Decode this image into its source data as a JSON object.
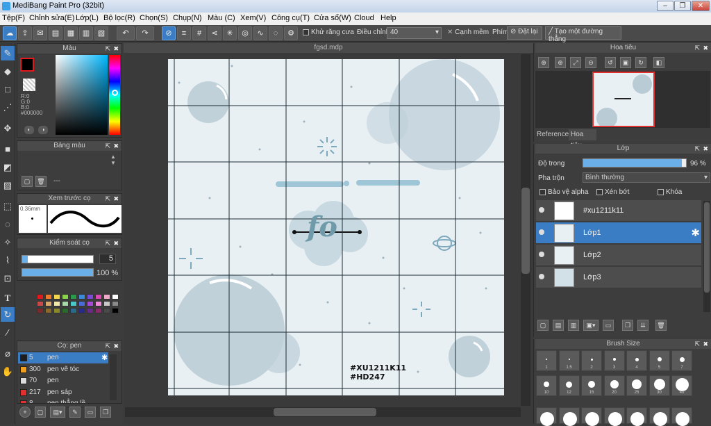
{
  "window": {
    "title": "MediBang Paint Pro (32bit)"
  },
  "menu": [
    "Tệp(F)",
    "Chỉnh sửa(E)",
    "Lớp(L)",
    "Bộ lọc(R)",
    "Chọn(S)",
    "Chụp(N)",
    "Màu (C)",
    "Xem(V)",
    "Công cụ(T)",
    "Cửa sổ(W)",
    "Cloud",
    "Help"
  ],
  "toolbar": {
    "antialias_label": "Khử răng cưa",
    "adjust_label": "Điều chỉnh",
    "adjust_value": "40",
    "soft_edge_label": "Cạnh mềm",
    "key_label": "Phím",
    "reset_label": "Đặt lại",
    "straight_line_label": "Tạo một đường thẳng"
  },
  "color_panel": {
    "title": "Màu",
    "r": "R:0",
    "g": "G:0",
    "b": "B:0",
    "hex": "#000000"
  },
  "palette_panel": {
    "title": "Bảng màu",
    "dash": "---",
    "colors": [
      "#e01a1a",
      "#f07a2a",
      "#f0d84a",
      "#8ad24a",
      "#2a9a4a",
      "#3a8ad8",
      "#7a4ad8",
      "#d84ab0",
      "#f0a8c8",
      "#ffffff",
      "#c84a4a",
      "#d8a86a",
      "#f0e8a8",
      "#a8d8a8",
      "#4ac8c8",
      "#4a6ad8",
      "#a84ad8",
      "#f08ad8",
      "#c8c8c8",
      "#8a8a8a",
      "#7a2a2a",
      "#8a6a2a",
      "#8a8a2a",
      "#2a6a2a",
      "#2a6a8a",
      "#2a2a8a",
      "#6a2a8a",
      "#8a2a6a",
      "#4a4a4a",
      "#000000"
    ]
  },
  "brush_preview": {
    "title": "Xem trước cọ",
    "size": "0.36mm"
  },
  "brush_control": {
    "title": "Kiểm soát cọ",
    "size_value": "5",
    "opacity_value": "100 %",
    "opacity_fraction": 1.0
  },
  "pen_panel": {
    "title": "Cọ: pen",
    "items": [
      {
        "size": "5",
        "name": "pen",
        "color": "#1e1e1e"
      },
      {
        "size": "300",
        "name": "pen vẽ tóc",
        "color": "#f0a020"
      },
      {
        "size": "70",
        "name": "pen",
        "color": "#dddddd"
      },
      {
        "size": "217",
        "name": "pen sáp",
        "color": "#e03030"
      },
      {
        "size": "8",
        "name": "pen thẳng lề",
        "color": "#e03030"
      }
    ]
  },
  "document": {
    "tab": "fgsd.mdp",
    "watermark_line1": "#XU1211K11",
    "watermark_line2": "#HD247",
    "center_text": "fo"
  },
  "navigator": {
    "title": "Hoa tiêu",
    "tabs": [
      "Reference",
      "Hoa tiêu"
    ]
  },
  "layer_panel": {
    "title": "Lớp",
    "opacity_label": "Độ trong",
    "opacity_value": "96 %",
    "opacity_fraction": 0.96,
    "blend_label": "Pha trộn",
    "blend_value": "Bình thường",
    "protect_alpha": "Bảo vệ alpha",
    "clipping": "Xén bớt",
    "lock": "Khóa",
    "layers": [
      {
        "name": "#xu1211k11"
      },
      {
        "name": "Lớp1"
      },
      {
        "name": "Lớp2"
      },
      {
        "name": "Lớp3"
      }
    ]
  },
  "brush_size_panel": {
    "title": "Brush Size",
    "row1": [
      "1",
      "1.5",
      "2",
      "3",
      "4",
      "5",
      "7"
    ],
    "row2": [
      "10",
      "12",
      "15",
      "20",
      "25",
      "30",
      "40"
    ]
  }
}
